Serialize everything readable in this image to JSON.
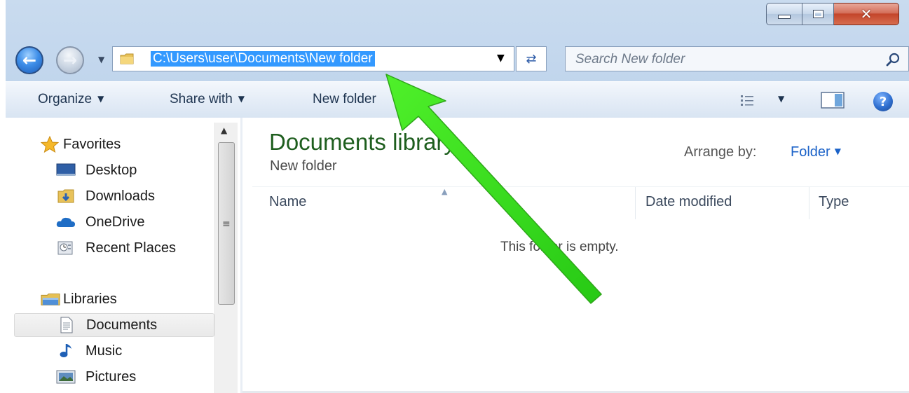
{
  "window": {
    "caption_buttons": {
      "close_glyph": "✕"
    }
  },
  "navigation": {
    "address": "C:\\Users\\user\\Documents\\New folder",
    "search_placeholder": "Search New folder"
  },
  "toolbar": {
    "organize_label": "Organize",
    "share_label": "Share with",
    "new_folder_label": "New folder",
    "help_glyph": "?"
  },
  "sidebar": {
    "favorites_header": "Favorites",
    "favorites": [
      "Desktop",
      "Downloads",
      "OneDrive",
      "Recent Places"
    ],
    "libraries_header": "Libraries",
    "libraries": [
      "Documents",
      "Music",
      "Pictures"
    ],
    "selected_item": "Documents"
  },
  "content": {
    "library_title": "Documents library",
    "library_subtitle": "New folder",
    "arrange_label": "Arrange by:",
    "arrange_value": "Folder",
    "columns": [
      "Name",
      "Date modified",
      "Type"
    ],
    "empty_message": "This folder is empty."
  },
  "colors": {
    "address_highlight": "#3399ff",
    "library_title": "#1e5e1e",
    "arrange_link": "#1b62c8",
    "annotation_arrow": "#33e61a"
  },
  "annotation": {
    "type": "arrow",
    "color": "#33e61a",
    "points_to": "address-bar"
  }
}
